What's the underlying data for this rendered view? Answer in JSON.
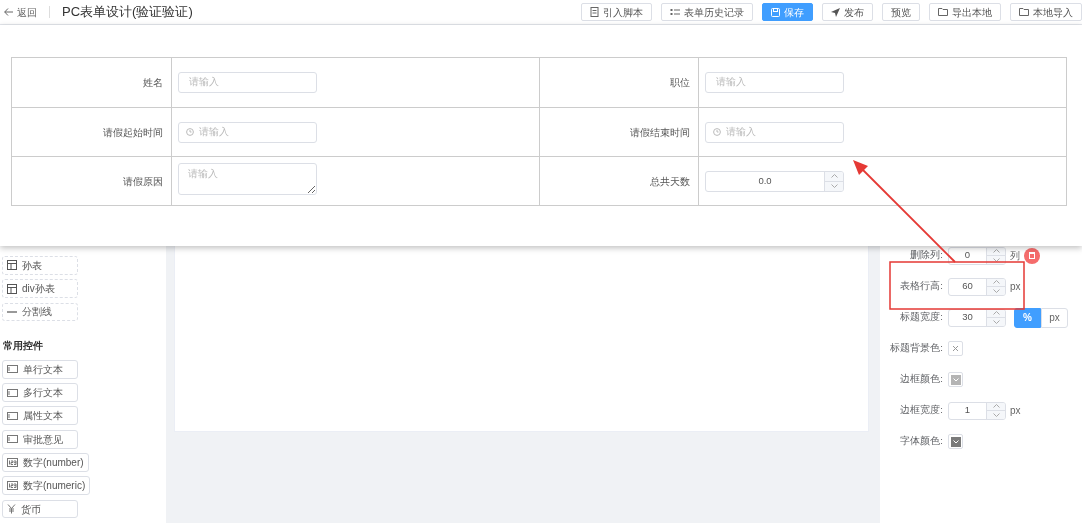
{
  "header": {
    "back_label": "返回",
    "title": "PC表单设计(验证验证)",
    "buttons": [
      {
        "label": "引入脚本",
        "kind": "document",
        "primary": false
      },
      {
        "label": "表单历史记录",
        "kind": "list",
        "primary": false
      },
      {
        "label": "保存",
        "kind": "save",
        "primary": true
      },
      {
        "label": "发布",
        "kind": "send",
        "primary": false
      },
      {
        "label": "预览",
        "kind": "plain",
        "primary": false
      },
      {
        "label": "导出本地",
        "kind": "folder",
        "primary": false
      },
      {
        "label": "本地导入",
        "kind": "folder",
        "primary": false
      }
    ]
  },
  "preview_form": {
    "rows": [
      {
        "cells": [
          {
            "label": "姓名",
            "field": {
              "kind": "text",
              "placeholder": "请输入"
            }
          },
          {
            "label": "职位",
            "field": {
              "kind": "text",
              "placeholder": "请输入"
            }
          }
        ]
      },
      {
        "cells": [
          {
            "label": "请假起始时间",
            "field": {
              "kind": "time",
              "placeholder": "请输入"
            }
          },
          {
            "label": "请假结束时间",
            "field": {
              "kind": "time",
              "placeholder": "请输入"
            }
          }
        ]
      },
      {
        "cells": [
          {
            "label": "请假原因",
            "field": {
              "kind": "textarea",
              "placeholder": "请输入"
            }
          },
          {
            "label": "总共天数",
            "field": {
              "kind": "number",
              "value": "0.0"
            }
          }
        ]
      }
    ]
  },
  "sidebar": {
    "groups": [
      {
        "items": [
          {
            "label": "孙表",
            "kind": "table"
          },
          {
            "label": "div孙表",
            "kind": "table"
          },
          {
            "label": "分割线",
            "kind": "divider"
          }
        ]
      },
      {
        "heading": "常用控件",
        "items": [
          {
            "label": "单行文本",
            "kind": "input"
          },
          {
            "label": "多行文本",
            "kind": "input"
          },
          {
            "label": "属性文本",
            "kind": "input"
          },
          {
            "label": "审批意见",
            "kind": "input"
          },
          {
            "label": "数字(number)",
            "kind": "number"
          },
          {
            "label": "数字(numeric)",
            "kind": "number"
          },
          {
            "label": "货币",
            "kind": "currency"
          }
        ]
      }
    ]
  },
  "properties": {
    "rows": [
      {
        "kind": "number",
        "label": "删除列:",
        "value": "0",
        "unit": "列",
        "delete_button": true
      },
      {
        "kind": "number",
        "label": "表格行高:",
        "value": "60",
        "unit": "px"
      },
      {
        "kind": "toggle",
        "label": "标题宽度:",
        "value": "30",
        "options": [
          {
            "label": "%",
            "selected": true
          },
          {
            "label": "px",
            "selected": false
          }
        ]
      },
      {
        "kind": "color",
        "label": "标题背景色:"
      },
      {
        "kind": "color",
        "label": "边框颜色:",
        "color": "#b4b4b4"
      },
      {
        "kind": "number",
        "label": "边框宽度:",
        "value": "1",
        "unit": "px"
      },
      {
        "kind": "color",
        "label": "字体颜色:",
        "color": "#7a7a7a"
      }
    ]
  }
}
